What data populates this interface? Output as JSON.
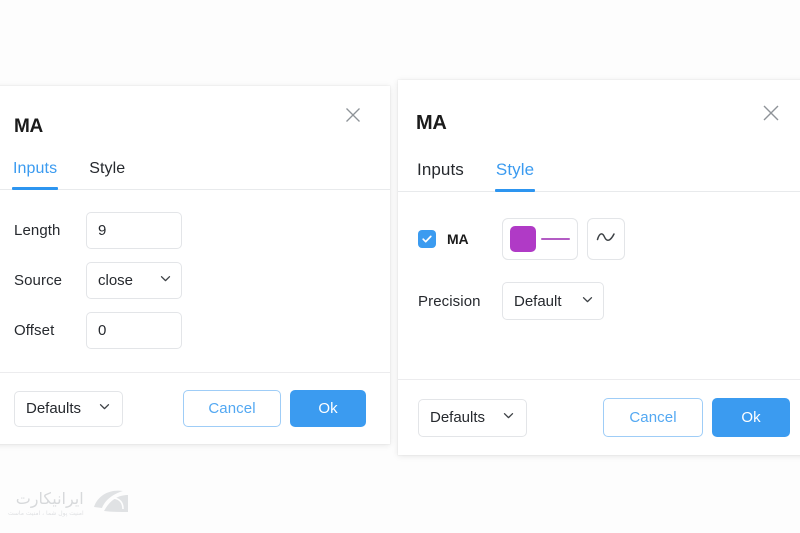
{
  "panels": {
    "left": {
      "title": "MA",
      "close_icon": "close-icon",
      "tabs": [
        {
          "label": "Inputs",
          "active": true
        },
        {
          "label": "Style",
          "active": false
        }
      ],
      "fields": [
        {
          "label": "Length",
          "type": "text",
          "value": "9"
        },
        {
          "label": "Source",
          "type": "select",
          "value": "close"
        },
        {
          "label": "Offset",
          "type": "text",
          "value": "0"
        }
      ],
      "footer": {
        "defaults_label": "Defaults",
        "cancel_label": "Cancel",
        "ok_label": "Ok"
      }
    },
    "right": {
      "title": "MA",
      "close_icon": "close-icon",
      "tabs": [
        {
          "label": "Inputs",
          "active": false
        },
        {
          "label": "Style",
          "active": true
        }
      ],
      "style": {
        "series_checked": true,
        "series_label": "MA",
        "series_color": "#b03ac6",
        "line_color": "#b35cc4",
        "line_style_icon": "wave-icon",
        "precision_label": "Precision",
        "precision_value": "Default"
      },
      "footer": {
        "defaults_label": "Defaults",
        "cancel_label": "Cancel",
        "ok_label": "Ok"
      }
    }
  },
  "theme": {
    "accent_blue": "#3b9bf0",
    "tab_underline": "#2d95f0",
    "border_gray": "#e3e5e8",
    "text_dark": "#26292e",
    "panel_bg": "#ffffff"
  },
  "watermark": {
    "brand": "ایرانیکارت",
    "tagline": "امنیت پول شما ، امنیت ماست"
  }
}
